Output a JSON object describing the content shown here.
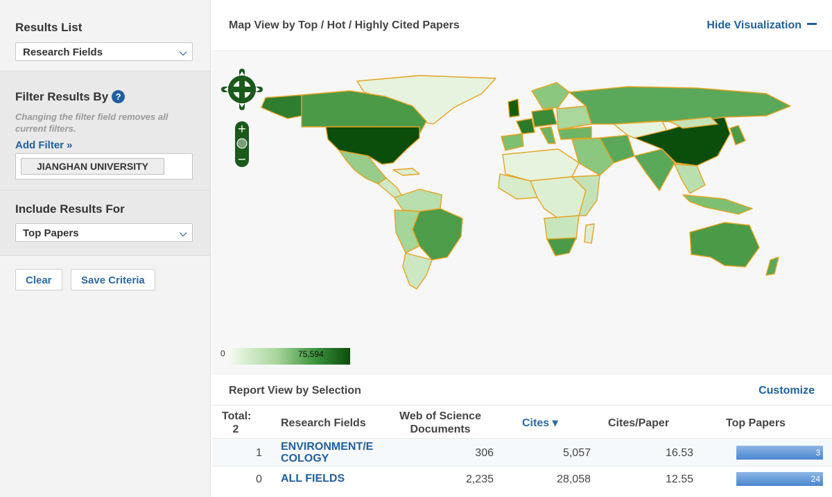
{
  "sidebar": {
    "results_list_label": "Results List",
    "results_list_value": "Research Fields",
    "filter_label": "Filter Results By",
    "filter_hint": "Changing the filter field removes all current filters.",
    "add_filter": "Add Filter »",
    "filter_chip": "JIANGHAN UNIVERSITY",
    "include_label": "Include Results For",
    "include_value": "Top Papers",
    "clear_button": "Clear",
    "save_button": "Save Criteria"
  },
  "visualization": {
    "title": "Map View by Top / Hot / Highly Cited Papers",
    "hide_label": "Hide Visualization",
    "legend_min": "0",
    "legend_max": "75,594"
  },
  "report": {
    "title": "Report View by Selection",
    "customize": "Customize",
    "total_label": "Total:",
    "total_value": "2",
    "columns": {
      "field": "Research Fields",
      "wos_line1": "Web of Science",
      "wos_line2": "Documents",
      "cites": "Cites ▾",
      "cites_per_paper": "Cites/Paper",
      "top_papers": "Top Papers"
    },
    "rows": [
      {
        "rank": "1",
        "field_line1": "ENVIRONMENT/E",
        "field_line2": "COLOGY",
        "wos": "306",
        "cites": "5,057",
        "cites_per_paper": "16.53",
        "top_papers": "3"
      },
      {
        "rank": "0",
        "field_line1": "ALL FIELDS",
        "field_line2": "",
        "wos": "2,235",
        "cites": "28,058",
        "cites_per_paper": "12.55",
        "top_papers": "24"
      }
    ]
  },
  "colors": {
    "link": "#1f5fa0",
    "map_dark": "#0b4d0b",
    "map_mid": "#5aa85a",
    "map_light": "#dcefd3",
    "country_border": "#e8a21e"
  }
}
